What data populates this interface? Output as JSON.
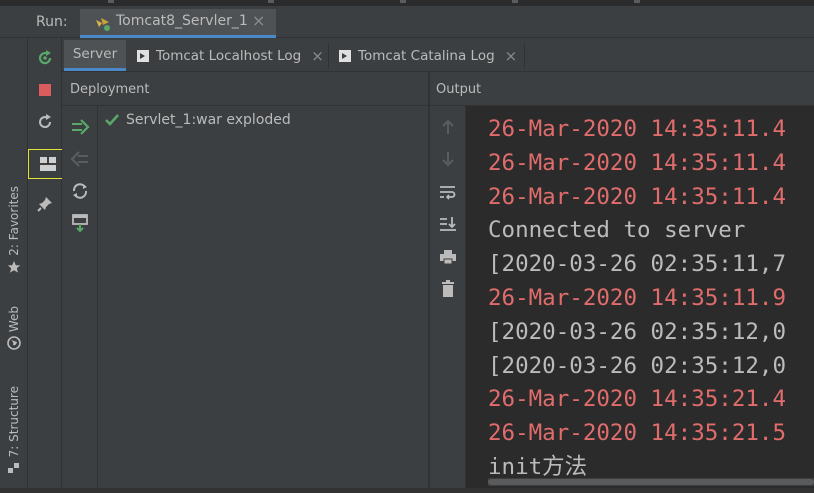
{
  "run": {
    "label": "Run:",
    "tab_title": "Tomcat8_Servler_1",
    "tab_close": "×"
  },
  "left_strip": {
    "favorites": "2: Favorites",
    "web": "Web",
    "structure": "7: Structure"
  },
  "tabs": [
    {
      "label": "Server",
      "active": true
    },
    {
      "label": "Tomcat Localhost Log",
      "close": "×"
    },
    {
      "label": "Tomcat Catalina Log",
      "close": "×"
    }
  ],
  "deployment": {
    "header": "Deployment",
    "items": [
      {
        "label": "Servlet_1:war exploded",
        "status": "deployed"
      }
    ]
  },
  "output": {
    "header": "Output",
    "lines": [
      {
        "text": "26-Mar-2020 14:35:11.4",
        "type": "error"
      },
      {
        "text": "26-Mar-2020 14:35:11.4",
        "type": "error"
      },
      {
        "text": "26-Mar-2020 14:35:11.4",
        "type": "error"
      },
      {
        "text": "Connected to server",
        "type": "normal"
      },
      {
        "text": "[2020-03-26 02:35:11,7",
        "type": "normal"
      },
      {
        "text": "26-Mar-2020 14:35:11.9",
        "type": "error"
      },
      {
        "text": "[2020-03-26 02:35:12,0",
        "type": "normal"
      },
      {
        "text": "[2020-03-26 02:35:12,0",
        "type": "normal"
      },
      {
        "text": "26-Mar-2020 14:35:21.4",
        "type": "error"
      },
      {
        "text": "26-Mar-2020 14:35:21.5",
        "type": "error"
      },
      {
        "text": "init方法",
        "type": "normal"
      }
    ]
  },
  "colors": {
    "accent": "#4a88c7",
    "error_text": "#e06c6c",
    "normal_text": "#bbbbbb",
    "green_icon": "#59a869",
    "red_icon": "#db5c5c",
    "selection_outline": "#e3e03a"
  }
}
